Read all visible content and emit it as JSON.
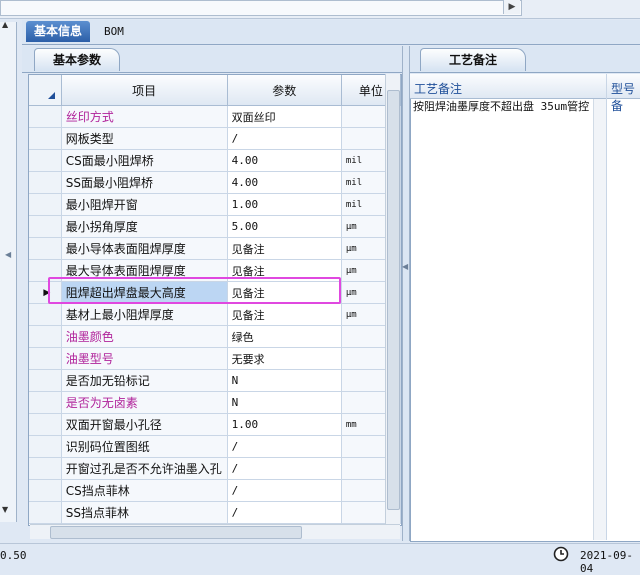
{
  "tabs": {
    "basic_info": "基本信息",
    "bom": "BOM"
  },
  "subtabs": {
    "basic_params": "基本参数",
    "process_notes": "工艺备注"
  },
  "grid": {
    "headers": {
      "item": "项目",
      "param": "参数",
      "unit": "单位"
    },
    "rows": [
      {
        "item": "丝印方式",
        "param": "双面丝印",
        "unit": "",
        "magenta": true
      },
      {
        "item": "网板类型",
        "param": "/",
        "unit": ""
      },
      {
        "item": "CS面最小阻焊桥",
        "param": "4.00",
        "unit": "mil"
      },
      {
        "item": "SS面最小阻焊桥",
        "param": "4.00",
        "unit": "mil"
      },
      {
        "item": "最小阻焊开窗",
        "param": "1.00",
        "unit": "mil"
      },
      {
        "item": "最小拐角厚度",
        "param": "5.00",
        "unit": "μm"
      },
      {
        "item": "最小导体表面阻焊厚度",
        "param": "见备注",
        "unit": "μm"
      },
      {
        "item": "最大导体表面阻焊厚度",
        "param": "见备注",
        "unit": "μm"
      },
      {
        "item": "阻焊超出焊盘最大高度",
        "param": "见备注",
        "unit": "μm",
        "selected": true
      },
      {
        "item": "基材上最小阻焊厚度",
        "param": "见备注",
        "unit": "μm"
      },
      {
        "item": "油墨颜色",
        "param": "绿色",
        "unit": "",
        "magenta": true
      },
      {
        "item": "油墨型号",
        "param": "无要求",
        "unit": "",
        "magenta": true
      },
      {
        "item": "是否加无铅标记",
        "param": "N",
        "unit": ""
      },
      {
        "item": "是否为无卤素",
        "param": "N",
        "unit": "",
        "magenta": true
      },
      {
        "item": "双面开窗最小孔径",
        "param": "1.00",
        "unit": "mm"
      },
      {
        "item": "识别码位置图纸",
        "param": "/",
        "unit": ""
      },
      {
        "item": "开窗过孔是否不允许油墨入孔",
        "param": "/",
        "unit": ""
      },
      {
        "item": "CS挡点菲林",
        "param": "/",
        "unit": ""
      },
      {
        "item": "SS挡点菲林",
        "param": "/",
        "unit": ""
      }
    ]
  },
  "notes_panel": {
    "col_process_note": "工艺备注",
    "col_model": "型号备",
    "note_text": "按阻焊油墨厚度不超出盘 35um管控"
  },
  "status": {
    "left_text": "0.50",
    "date": "2021-09-04"
  },
  "colors": {
    "magenta_text": "#b0229a",
    "highlight_box": "#e048e0",
    "tab_active": "#2c5fa8"
  }
}
